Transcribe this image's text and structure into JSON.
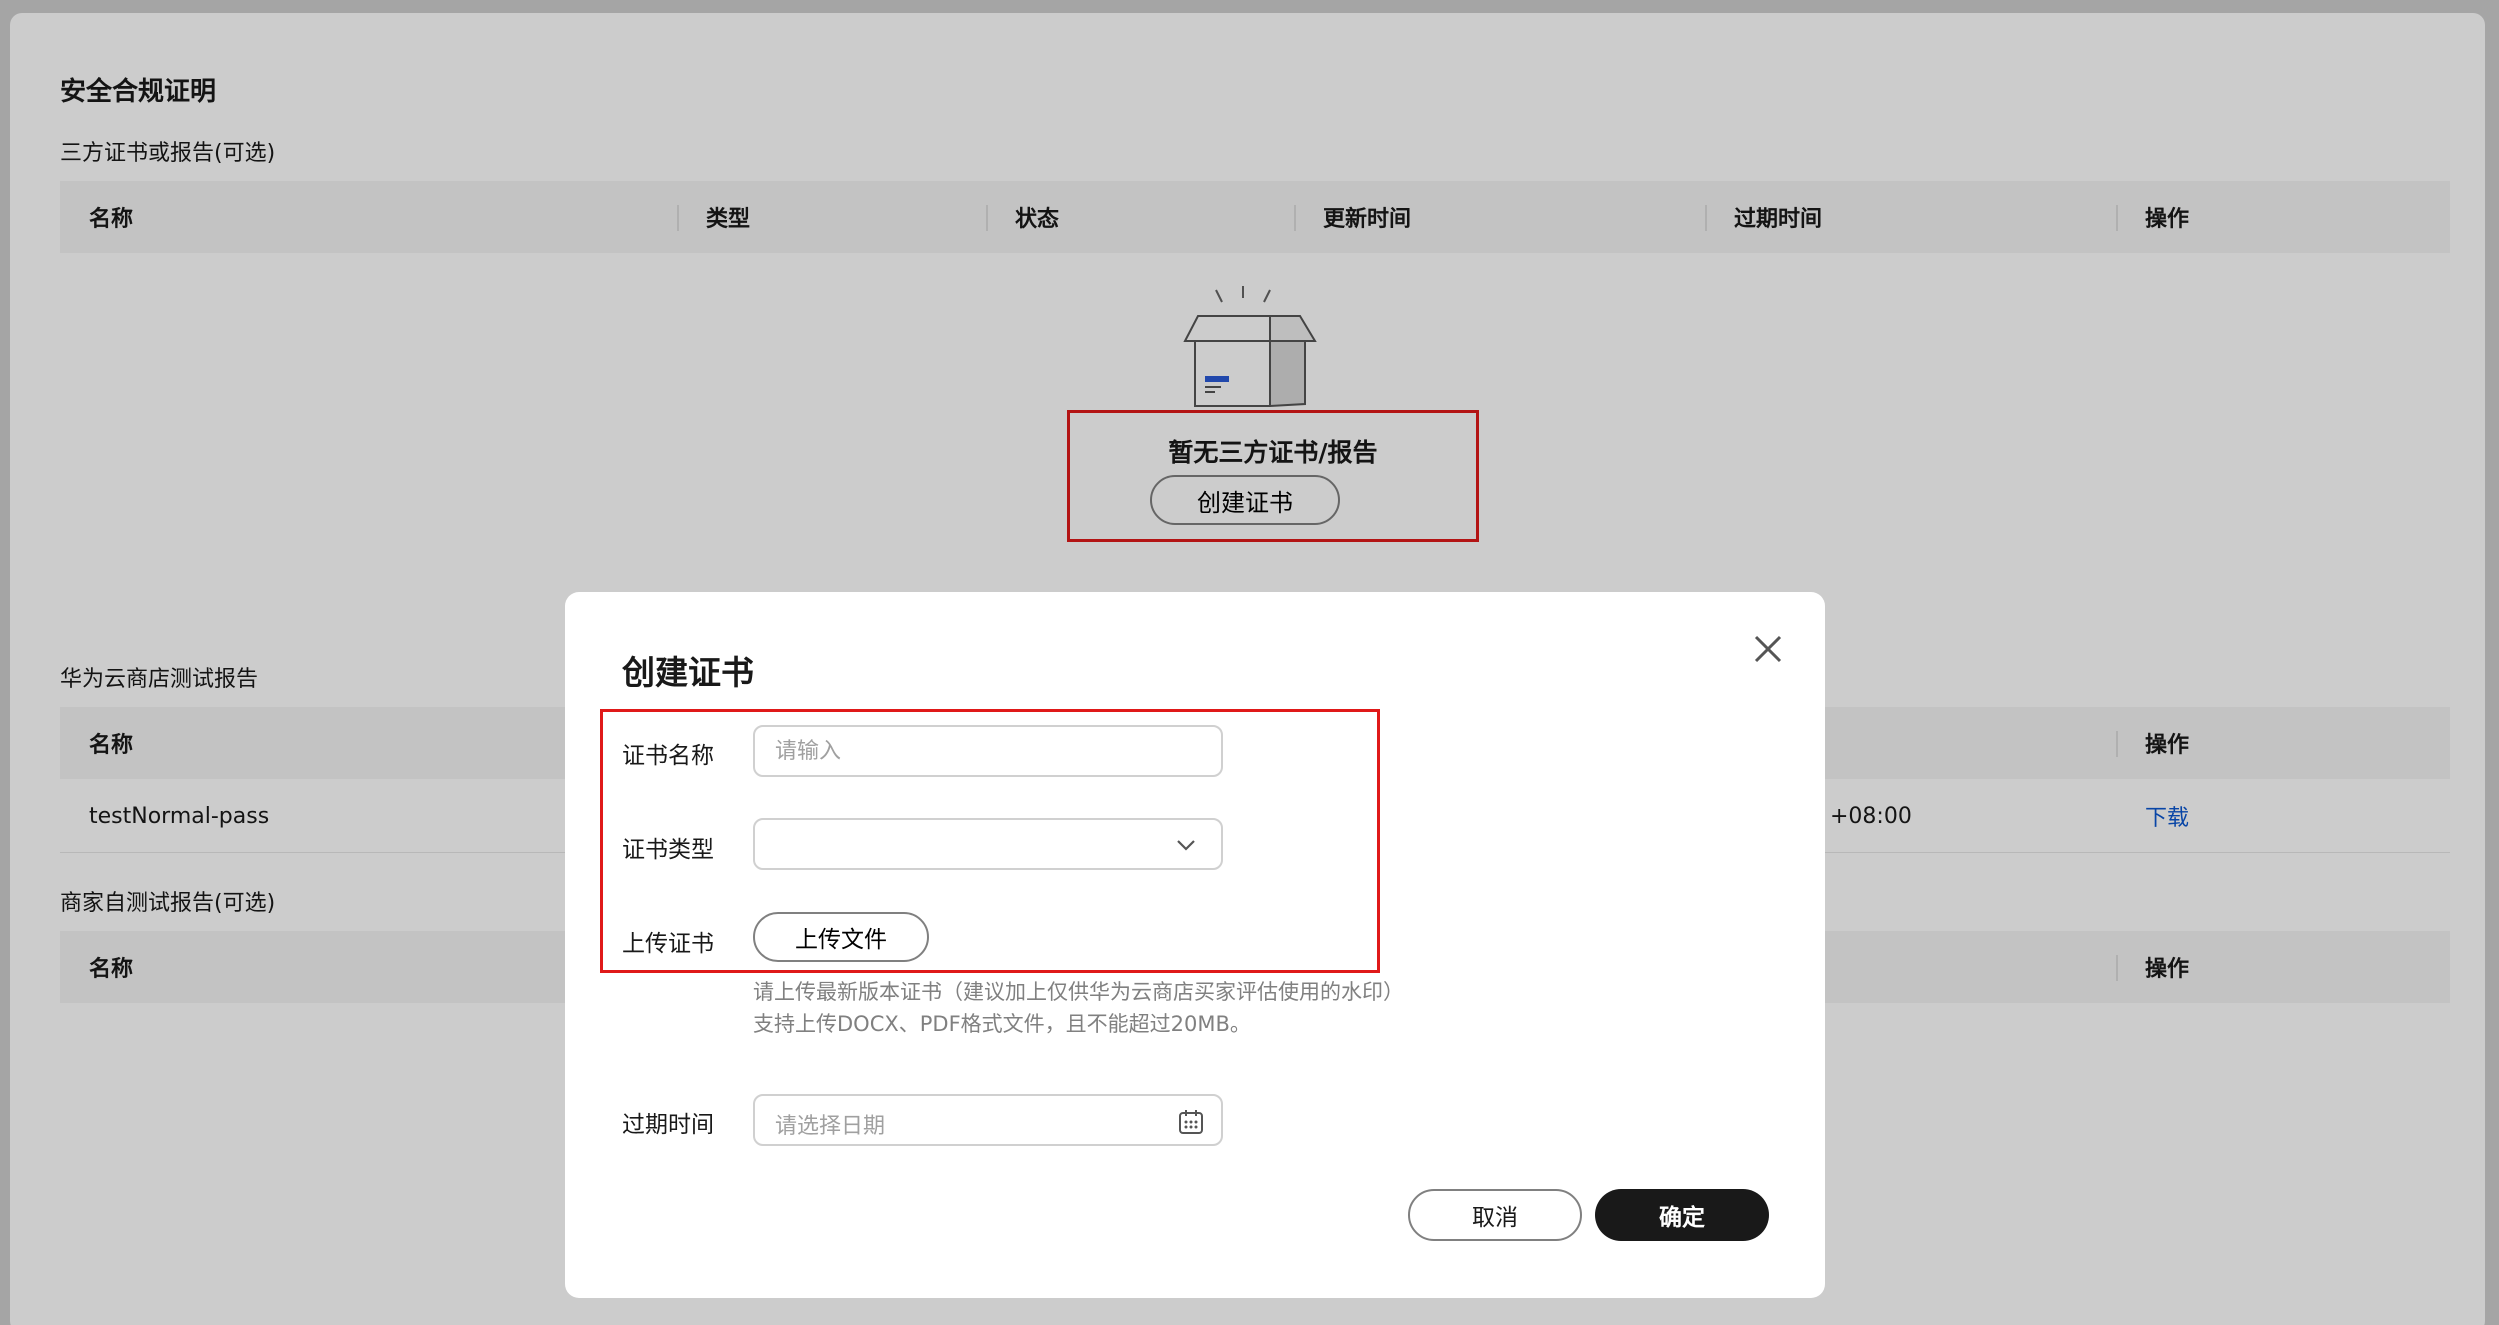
{
  "page": {
    "title": "安全合规证明",
    "section1_label": "三方证书或报告(可选)",
    "section2_label": "华为云商店测试报告",
    "section3_label": "商家自测试报告(可选)"
  },
  "table1": {
    "headers": [
      "名称",
      "类型",
      "状态",
      "更新时间",
      "过期时间",
      "操作"
    ],
    "empty_text": "暂无三方证书/报告",
    "create_label": "创建证书"
  },
  "table2": {
    "headers": [
      "名称",
      "操作"
    ],
    "rows": [
      {
        "name": "testNormal-pass",
        "time_tail": "+08:00",
        "action": "下载"
      }
    ]
  },
  "table3": {
    "headers": [
      "名称",
      "操作"
    ]
  },
  "modal": {
    "title": "创建证书",
    "name_label": "证书名称",
    "name_placeholder": "请输入",
    "type_label": "证书类型",
    "type_value": "",
    "upload_label": "上传证书",
    "upload_button": "上传文件",
    "hint1": "请上传最新版本证书（建议加上仅供华为云商店买家评估使用的水印）",
    "hint2": "支持上传DOCX、PDF格式文件，且不能超过20MB。",
    "expire_label": "过期时间",
    "expire_placeholder": "请选择日期",
    "cancel": "取消",
    "confirm": "确定"
  },
  "colors": {
    "accent": "#191919",
    "link": "#0b57d0",
    "highlight": "#e01919"
  }
}
